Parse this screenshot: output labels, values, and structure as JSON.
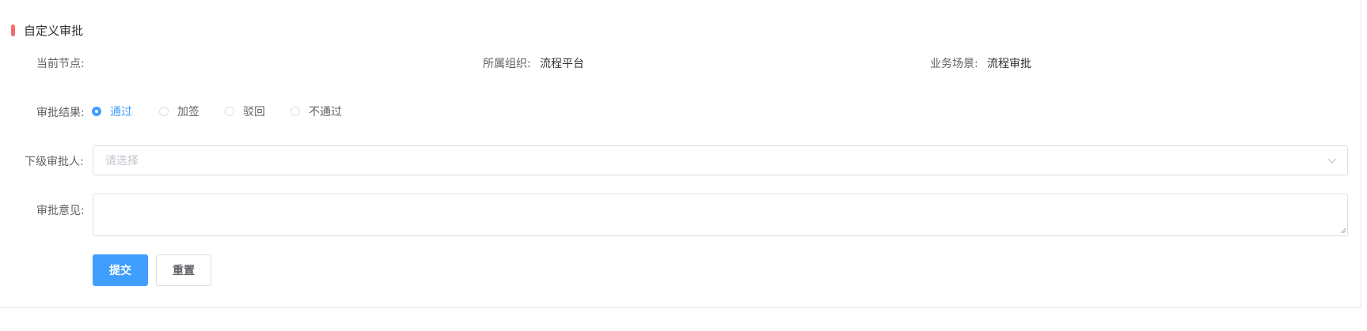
{
  "colors": {
    "accent": "#409eff",
    "title_marker": "#f56c6c"
  },
  "section": {
    "title": "自定义审批"
  },
  "info": {
    "current_node_label": "当前节点:",
    "current_node_value": "",
    "org_label": "所属组织:",
    "org_value": "流程平台",
    "scene_label": "业务场景:",
    "scene_value": "流程审批"
  },
  "form": {
    "result_label": "审批结果:",
    "result_options": [
      "通过",
      "加签",
      "驳回",
      "不通过"
    ],
    "result_selected": "通过",
    "next_approver_label": "下级审批人:",
    "next_approver_placeholder": "请选择",
    "comment_label": "审批意见:",
    "comment_value": ""
  },
  "actions": {
    "submit_label": "提交",
    "reset_label": "重置"
  }
}
